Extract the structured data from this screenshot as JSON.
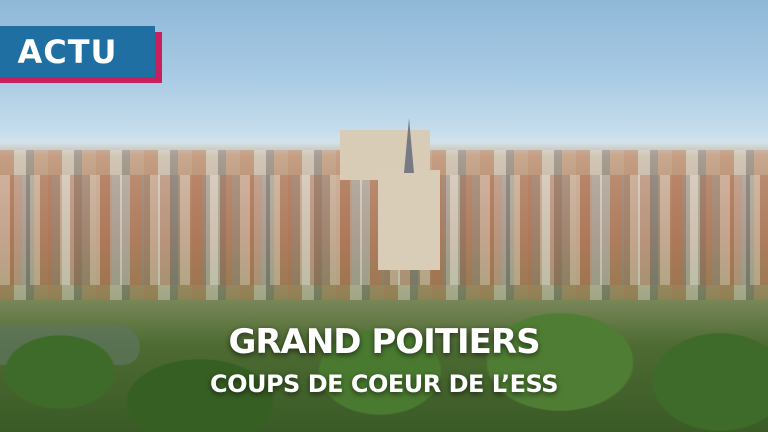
{
  "badge": {
    "label": "ACTU",
    "color": "#1f6fa2",
    "accent": "#c8205e"
  },
  "headline": {
    "title": "GRAND POITIERS",
    "subtitle": "COUPS DE COEUR DE L’ESS"
  }
}
